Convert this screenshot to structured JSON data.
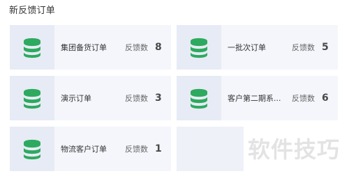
{
  "section": {
    "title": "新反馈订单"
  },
  "cards": [
    {
      "name": "集团备货订单",
      "count_label": "反馈数",
      "count": "8"
    },
    {
      "name": "一批次订单",
      "count_label": "反馈数",
      "count": "5"
    },
    {
      "name": "演示订单",
      "count_label": "反馈数",
      "count": "3"
    },
    {
      "name": "客户第二期系...",
      "count_label": "反馈数",
      "count": "6"
    },
    {
      "name": "物流客户订单",
      "count_label": "反馈数",
      "count": "1"
    }
  ],
  "icons": {
    "card_icon": "database-icon",
    "card_icon_color": "#2daa5f"
  },
  "watermark": {
    "text": "软件技巧"
  }
}
